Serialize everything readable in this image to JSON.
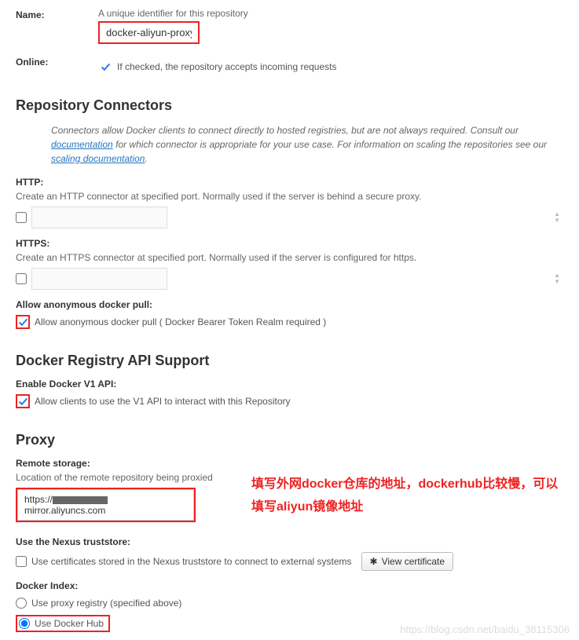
{
  "name": {
    "label": "Name:",
    "hint": "A unique identifier for this repository",
    "value": "docker-aliyun-proxy"
  },
  "online": {
    "label": "Online:",
    "checkbox_label": "If checked, the repository accepts incoming requests"
  },
  "connectors": {
    "heading": "Repository Connectors",
    "desc_1": "Connectors allow Docker clients to connect directly to hosted registries, but are not always required. Consult our ",
    "link_1": "documentation",
    "desc_2": " for which connector is appropriate for your use case. For information on scaling the repositories see our ",
    "link_2": "scaling documentation",
    "desc_3": ".",
    "http": {
      "label": "HTTP:",
      "hint": "Create an HTTP connector at specified port. Normally used if the server is behind a secure proxy."
    },
    "https": {
      "label": "HTTPS:",
      "hint": "Create an HTTPS connector at specified port. Normally used if the server is configured for https."
    },
    "anon": {
      "label": "Allow anonymous docker pull:",
      "checkbox_label": "Allow anonymous docker pull ( Docker Bearer Token Realm required )"
    }
  },
  "api": {
    "heading": "Docker Registry API Support",
    "v1": {
      "label": "Enable Docker V1 API:",
      "checkbox_label": "Allow clients to use the V1 API to interact with this Repository"
    }
  },
  "proxy": {
    "heading": "Proxy",
    "remote": {
      "label": "Remote storage:",
      "hint": "Location of the remote repository being proxied",
      "value_prefix": "https://",
      "value_suffix": "mirror.aliyuncs.com"
    },
    "truststore": {
      "label": "Use the Nexus truststore:",
      "checkbox_label": "Use certificates stored in the Nexus truststore to connect to external systems",
      "button": "View certificate"
    },
    "index": {
      "label": "Docker Index:",
      "option_proxy": "Use proxy registry (specified above)",
      "option_hub": "Use Docker Hub"
    }
  },
  "annotation": "填写外网docker仓库的地址，dockerhub比较慢，可以填写aliyun镜像地址",
  "watermark": "https://blog.csdn.net/baidu_38115306"
}
